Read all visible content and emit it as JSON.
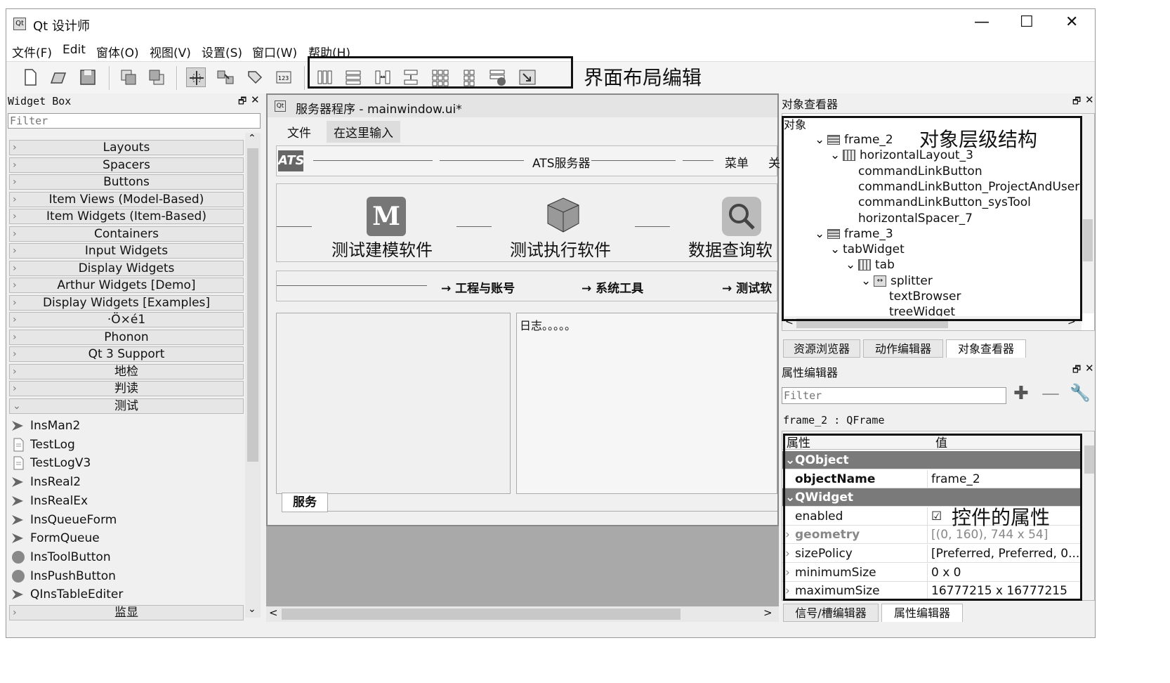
{
  "window": {
    "title": "Qt 设计师",
    "minimize": "—",
    "maximize": "☐",
    "close": "✕"
  },
  "menus": [
    "文件(F)",
    "Edit",
    "窗体(O)",
    "视图(V)",
    "设置(S)",
    "窗口(W)",
    "帮助(H)"
  ],
  "annotations": {
    "layout_edit": "界面布局编辑",
    "object_hierarchy": "对象层级结构",
    "widget_props": "控件的属性"
  },
  "widget_box": {
    "title": "Widget Box",
    "filter_placeholder": "Filter",
    "categories": [
      "Layouts",
      "Spacers",
      "Buttons",
      "Item Views (Model-Based)",
      "Item Widgets (Item-Based)",
      "Containers",
      "Input Widgets",
      "Display Widgets",
      "Arthur Widgets [Demo]",
      "Display Widgets [Examples]",
      "·Ö×é1",
      "Phonon",
      "Qt 3 Support",
      "地检",
      "判读",
      "测试"
    ],
    "items": [
      "InsMan2",
      "TestLog",
      "TestLogV3",
      "InsReal2",
      "InsRealEx",
      "InsQueueForm",
      "FormQueue",
      "InsToolButton",
      "InsPushButton",
      "QInsTableEditer"
    ],
    "last_category": "监显"
  },
  "form": {
    "title": "服务器程序 - mainwindow.ui*",
    "menu_file": "文件",
    "menu_placeholder": "在这里输入",
    "logo": "ATS",
    "toolbar_title": "ATS服务器",
    "toolbar_menu": "菜单",
    "toolbar_more": "关",
    "big_buttons": [
      "测试建模软件",
      "测试执行软件",
      "数据查询软"
    ],
    "link_buttons": [
      "工程与账号",
      "系统工具",
      "测试软"
    ],
    "log_text": "日志。。。。。",
    "tab": "服务"
  },
  "object_inspector": {
    "title": "对象查看器",
    "header": "对象",
    "tree": [
      {
        "label": "frame_2",
        "level": 1,
        "icon": "frame"
      },
      {
        "label": "horizontalLayout_3",
        "level": 2,
        "icon": "hlayout"
      },
      {
        "label": "commandLinkButton",
        "level": 3,
        "icon": ""
      },
      {
        "label": "commandLinkButton_ProjectAndUser",
        "level": 3,
        "icon": ""
      },
      {
        "label": "commandLinkButton_sysTool",
        "level": 3,
        "icon": ""
      },
      {
        "label": "horizontalSpacer_7",
        "level": 3,
        "icon": ""
      },
      {
        "label": "frame_3",
        "level": 1,
        "icon": "frame"
      },
      {
        "label": "tabWidget",
        "level": 2,
        "icon": ""
      },
      {
        "label": "tab",
        "level": 3,
        "icon": "hlayout"
      },
      {
        "label": "splitter",
        "level": 4,
        "icon": "splitter"
      },
      {
        "label": "textBrowser",
        "level": 5,
        "icon": ""
      },
      {
        "label": "treeWidget",
        "level": 5,
        "icon": ""
      }
    ],
    "tabs": [
      "资源浏览器",
      "动作编辑器",
      "对象查看器"
    ]
  },
  "property_editor": {
    "title": "属性编辑器",
    "filter_placeholder": "Filter",
    "object": "frame_2 : QFrame",
    "col_prop": "属性",
    "col_value": "值",
    "rows": [
      {
        "type": "group",
        "key": "QObject"
      },
      {
        "type": "prop",
        "key": "objectName",
        "value": "frame_2",
        "bold": true
      },
      {
        "type": "group",
        "key": "QWidget"
      },
      {
        "type": "prop",
        "key": "enabled",
        "value": "☑"
      },
      {
        "type": "prop",
        "key": "geometry",
        "value": "[(0, 160), 744 x 54]",
        "grey": true
      },
      {
        "type": "prop",
        "key": "sizePolicy",
        "value": "[Preferred, Preferred, 0..."
      },
      {
        "type": "prop",
        "key": "minimumSize",
        "value": "0 x 0"
      },
      {
        "type": "prop",
        "key": "maximumSize",
        "value": "16777215 x 16777215"
      }
    ],
    "tabs": [
      "信号/槽编辑器",
      "属性编辑器"
    ]
  },
  "colors": {
    "group_bg": "#7a7a7a",
    "panel_bg": "#f0f0f0",
    "mdi_bg": "#a9a9a9"
  }
}
